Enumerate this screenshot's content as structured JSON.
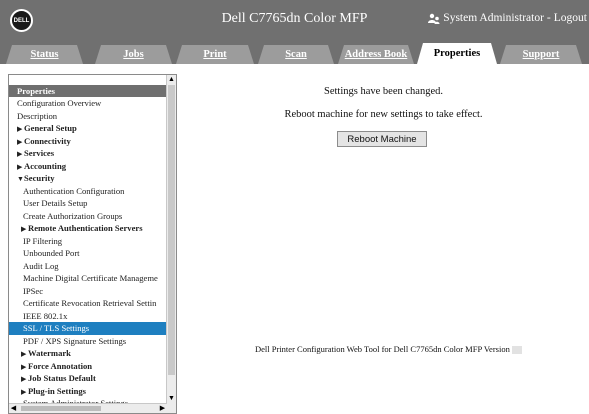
{
  "header": {
    "logo_text": "DELL",
    "title": "Dell C7765dn Color MFP",
    "user_label": "System Administrator",
    "separator": "-",
    "logout_label": "Logout"
  },
  "tabs": [
    {
      "label": "Status"
    },
    {
      "label": "Jobs"
    },
    {
      "label": "Print"
    },
    {
      "label": "Scan"
    },
    {
      "label": "Address Book"
    },
    {
      "label": "Properties"
    },
    {
      "label": "Support"
    }
  ],
  "sidebar": {
    "header": "Properties",
    "items": [
      {
        "label": "Configuration Overview"
      },
      {
        "label": "Description"
      },
      {
        "label": "General Setup",
        "arrow": "▶"
      },
      {
        "label": "Connectivity",
        "arrow": "▶"
      },
      {
        "label": "Services",
        "arrow": "▶"
      },
      {
        "label": "Accounting",
        "arrow": "▶"
      },
      {
        "label": "Security",
        "arrow": "▼"
      },
      {
        "label": "Authentication Configuration"
      },
      {
        "label": "User Details Setup"
      },
      {
        "label": "Create Authorization Groups"
      },
      {
        "label": "Remote Authentication Servers",
        "arrow": "▶"
      },
      {
        "label": "IP Filtering"
      },
      {
        "label": "Unbounded Port"
      },
      {
        "label": "Audit Log"
      },
      {
        "label": "Machine Digital Certificate Manageme"
      },
      {
        "label": "IPSec"
      },
      {
        "label": "Certificate Revocation Retrieval Settin"
      },
      {
        "label": "IEEE 802.1x"
      },
      {
        "label": "SSL / TLS Settings"
      },
      {
        "label": "PDF / XPS Signature Settings"
      },
      {
        "label": "Watermark",
        "arrow": "▶"
      },
      {
        "label": "Force Annotation",
        "arrow": "▶"
      },
      {
        "label": "Job Status Default",
        "arrow": "▶"
      },
      {
        "label": "Plug-in Settings",
        "arrow": "▶"
      },
      {
        "label": "System Administrator Settings"
      }
    ],
    "selected": "SSL / TLS Settings"
  },
  "main": {
    "message": "Settings have been changed.",
    "instruction": "Reboot machine for new settings to take effect.",
    "reboot_button": "Reboot Machine",
    "footer_text": "Dell Printer Configuration Web Tool for Dell C7765dn Color MFP Version"
  },
  "colors": {
    "header_bg": "#707070",
    "tab_bg": "#9c9c9c",
    "selected_item": "#1e7fc0"
  }
}
